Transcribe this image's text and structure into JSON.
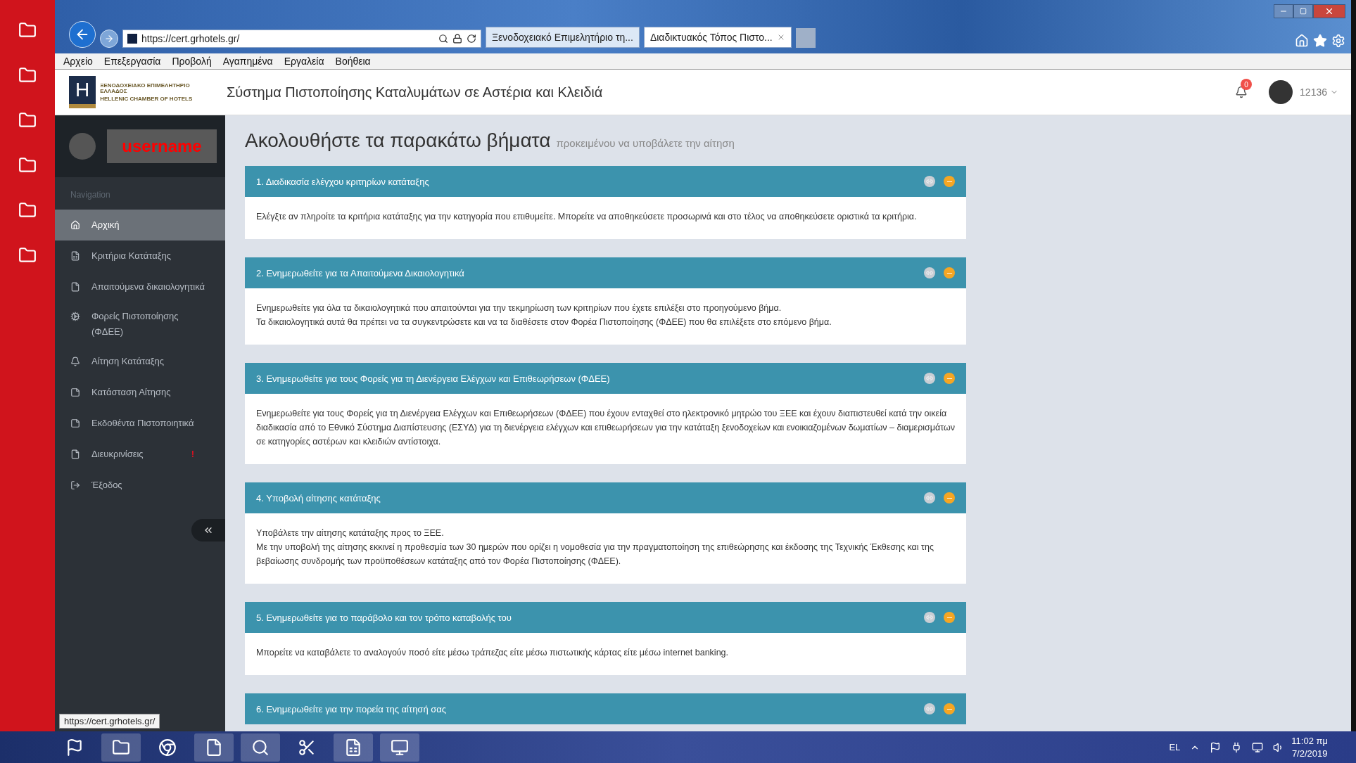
{
  "browser": {
    "address": "https://cert.grhotels.gr/",
    "tabs": [
      {
        "label": "Ξενοδοχειακό Επιμελητήριο τη...",
        "selected": false
      },
      {
        "label": "Διαδικτυακός Τόπος Πιστο...",
        "selected": true
      }
    ],
    "menu": [
      "Αρχείο",
      "Επεξεργασία",
      "Προβολή",
      "Αγαπημένα",
      "Εργαλεία",
      "Βοήθεια"
    ]
  },
  "header": {
    "logo_letter": "H",
    "logo_line1": "ΞΕΝΟΔΟΧΕΙΑΚΟ ΕΠΙΜΕΛΗΤΗΡΙΟ ΕΛΛΑΔΟΣ",
    "logo_line2": "HELLENIC CHAMBER OF HOTELS",
    "title": "Σύστημα Πιστοποίησης Καταλυμάτων σε Αστέρια και Κλειδιά",
    "notifications": "0",
    "user": "12136"
  },
  "sidebar": {
    "username": "username",
    "section": "Navigation",
    "items": [
      {
        "label": "Αρχική",
        "selected": true
      },
      {
        "label": "Κριτήρια Κατάταξης",
        "selected": false
      },
      {
        "label": "Απαιτούμενα δικαιολογητικά",
        "selected": false
      },
      {
        "label": "Φορείς Πιστοποίησης (ΦΔΕΕ)",
        "selected": false
      },
      {
        "label": "Αίτηση Κατάταξης",
        "selected": false
      },
      {
        "label": "Κατάσταση Αίτησης",
        "selected": false
      },
      {
        "label": "Εκδοθέντα Πιστοποιητικά",
        "selected": false
      },
      {
        "label": "Διευκρινίσεις",
        "selected": false,
        "badge": "!"
      },
      {
        "label": "Έξοδος",
        "selected": false
      }
    ]
  },
  "page": {
    "title": "Ακολουθήστε τα παρακάτω βήματα",
    "subtitle": "προκειμένου να υποβάλετε την αίτηση"
  },
  "steps": [
    {
      "title": "1. Διαδικασία ελέγχου κριτηρίων κατάταξης",
      "paragraphs": [
        "Ελέγξτε αν πληροίτε τα κριτήρια κατάταξης για την κατηγορία που επιθυμείτε. Μπορείτε να αποθηκεύσετε προσωρινά και στο τέλος να αποθηκεύσετε οριστικά τα κριτήρια."
      ]
    },
    {
      "title": "2. Ενημερωθείτε για τα Απαιτούμενα Δικαιολογητικά",
      "paragraphs": [
        "Ενημερωθείτε για όλα τα δικαιολογητικά που απαιτούνται για την τεκμηρίωση των κριτηρίων που έχετε επιλέξει στο προηγούμενο βήμα.",
        "Τα δικαιολογητικά αυτά θα πρέπει να τα συγκεντρώσετε και να τα διαθέσετε στον Φορέα Πιστοποίησης (ΦΔΕΕ) που θα επιλέξετε στο επόμενο βήμα."
      ]
    },
    {
      "title": "3. Ενημερωθείτε για τους Φορείς για τη Διενέργεια Ελέγχων και Επιθεωρήσεων (ΦΔΕΕ)",
      "paragraphs": [
        "Ενημερωθείτε για τους Φορείς για τη Διενέργεια Ελέγχων και Επιθεωρήσεων (ΦΔΕΕ) που έχουν ενταχθεί στο ηλεκτρονικό μητρώο του ΞΕΕ και έχουν διαπιστευθεί κατά την οικεία διαδικασία από το Εθνικό Σύστημα Διαπίστευσης (ΕΣΥΔ) για τη διενέργεια ελέγχων και επιθεωρήσεων για την κατάταξη ξενοδοχείων και ενοικιαζομένων δωματίων – διαμερισμάτων σε κατηγορίες αστέρων και κλειδιών αντίστοιχα."
      ]
    },
    {
      "title": "4. Υποβολή αίτησης κατάταξης",
      "paragraphs": [
        "Υποβάλετε την αίτησης κατάταξης προς το ΞΕΕ.",
        "Με την υποβολή της αίτησης εκκινεί η προθεσμία των 30 ημερών που ορίζει η νομοθεσία για την πραγματοποίηση της επιθεώρησης και έκδοσης της Τεχνικής Έκθεσης και της βεβαίωσης συνδρομής των προϋποθέσεων κατάταξης από τον Φορέα Πιστοποίησης (ΦΔΕΕ)."
      ]
    },
    {
      "title": "5. Ενημερωθείτε για το παράβολο και τον τρόπο καταβολής του",
      "paragraphs": [
        "Μπορείτε να καταβάλετε το αναλογούν ποσό είτε μέσω τράπεζας είτε μέσω πιστωτικής κάρτας είτε μέσω internet banking."
      ]
    },
    {
      "title": "6. Ενημερωθείτε για την πορεία της αίτησή σας"
    }
  ],
  "status_url": "https://cert.grhotels.gr/",
  "taskbar": {
    "language": "EL",
    "time": "11:02 πμ",
    "date": "7/2/2019"
  }
}
